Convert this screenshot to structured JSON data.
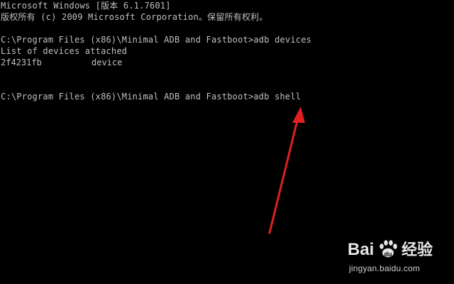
{
  "console": {
    "line1": "Microsoft Windows [版本 6.1.7601]",
    "line2": "版权所有 (c) 2009 Microsoft Corporation。保留所有权利。",
    "line3": "C:\\Program Files (x86)\\Minimal ADB and Fastboot>adb devices",
    "line4": "List of devices attached",
    "device_id": "2f4231fb",
    "device_state": "device",
    "line6": "C:\\Program Files (x86)\\Minimal ADB and Fastboot>adb shell"
  },
  "annotation": {
    "arrow_color": "#e02020",
    "icon": "red-arrow-icon"
  },
  "watermark": {
    "brand": "Bai 经验",
    "url": "jingyan.baidu.com",
    "icon": "baidu-paw-icon"
  },
  "colors": {
    "background": "#000000",
    "text": "#c0c0c0"
  }
}
